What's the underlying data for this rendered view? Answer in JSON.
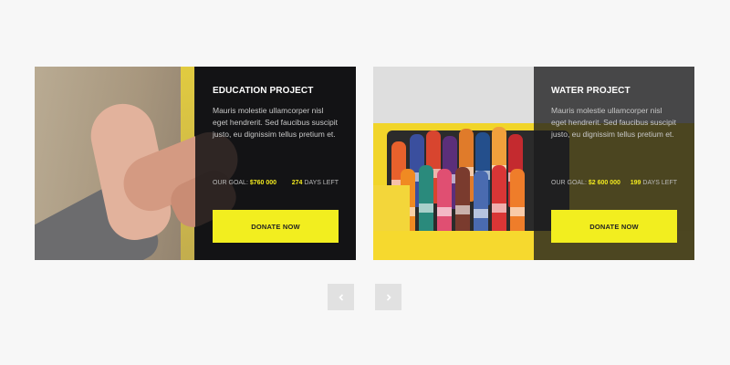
{
  "cards": [
    {
      "title": "EDUCATION PROJECT",
      "description": "Mauris molestie ullamcorper nisl eget hendrerit. Sed faucibus suscipit justo, eu dignissim tellus pretium et.",
      "goal_label": "OUR GOAL:",
      "goal_value": "$760 000",
      "days_value": "274",
      "days_label": "DAYS LEFT",
      "button_label": "DONATE NOW",
      "image": "hands-photo"
    },
    {
      "title": "WATER PROJECT",
      "description": "Mauris molestie ullamcorper nisl eget hendrerit. Sed faucibus suscipit justo, eu dignissim tellus pretium et.",
      "goal_label": "OUR GOAL:",
      "goal_value": "$2 600 000",
      "days_value": "199",
      "days_label": "DAYS LEFT",
      "button_label": "DONATE NOW",
      "image": "crayons-photo"
    }
  ],
  "nav": {
    "prev_icon": "chevron-left-icon",
    "next_icon": "chevron-right-icon"
  },
  "colors": {
    "accent": "#f2ee1f",
    "panel": "#121214",
    "background": "#f7f7f7",
    "nav": "#e1e1e1"
  }
}
